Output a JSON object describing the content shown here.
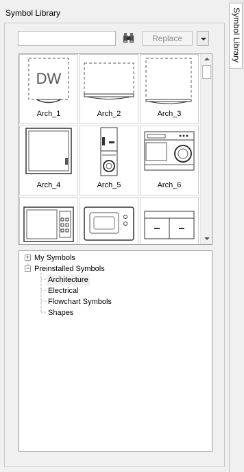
{
  "panel": {
    "title": "Symbol Library"
  },
  "side_tab": {
    "label": "Symbol Library"
  },
  "search": {
    "value": "",
    "placeholder": ""
  },
  "toolbar": {
    "find_icon": "binoculars-icon",
    "replace_label": "Replace",
    "dropdown_icon": "chevron-down-icon"
  },
  "gallery": {
    "tiles": [
      {
        "label": "Arch_1",
        "icon": "dw-symbol-icon"
      },
      {
        "label": "Arch_2",
        "icon": "dashed-box-icon"
      },
      {
        "label": "Arch_3",
        "icon": "dashed-box-icon"
      },
      {
        "label": "Arch_4",
        "icon": "microwave-box-icon"
      },
      {
        "label": "Arch_5",
        "icon": "stacked-washer-icon"
      },
      {
        "label": "Arch_6",
        "icon": "washer-icon"
      },
      {
        "label": "",
        "icon": "microwave-icon"
      },
      {
        "label": "",
        "icon": "microwave-icon"
      },
      {
        "label": "",
        "icon": "cabinet-icon"
      }
    ]
  },
  "tree": {
    "nodes": [
      {
        "label": "My Symbols",
        "expander": "+"
      },
      {
        "label": "Preinstalled Symbols",
        "expander": "−"
      },
      {
        "label": "Architecture",
        "selected": true
      },
      {
        "label": "Electrical"
      },
      {
        "label": "Flowchart Symbols"
      },
      {
        "label": "Shapes"
      }
    ]
  }
}
